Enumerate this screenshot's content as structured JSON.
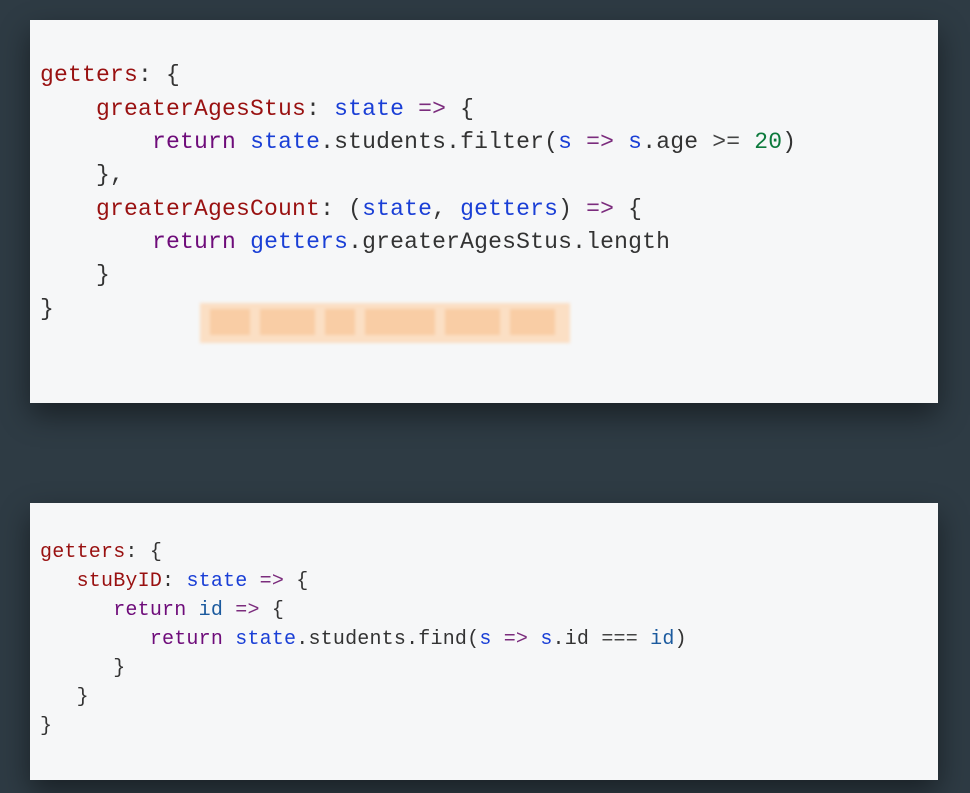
{
  "block1": {
    "l1_getters": "getters",
    "l1_colonBrace": ": {",
    "l2_indent": "    ",
    "l2_name": "greaterAgesStus",
    "l2_colon": ": ",
    "l2_state": "state",
    "l2_arrow": " => ",
    "l2_brace": "{",
    "l3_indent": "        ",
    "l3_return": "return",
    "l3_sp": " ",
    "l3_state": "state",
    "l3_dot1": ".students.",
    "l3_filter": "filter",
    "l3_p1": "(",
    "l3_s": "s",
    "l3_arrow": " => ",
    "l3_s2": "s",
    "l3_age": ".age ",
    "l3_op": ">=",
    "l3_sp2": " ",
    "l3_num": "20",
    "l3_p2": ")",
    "l4_indent": "    ",
    "l4_close": "},",
    "l5_indent": "    ",
    "l5_name": "greaterAgesCount",
    "l5_colon": ": (",
    "l5_state": "state",
    "l5_comma": ", ",
    "l5_getters": "getters",
    "l5_p2": ")",
    "l5_arrow": " => ",
    "l5_brace": "{",
    "l6_indent": "        ",
    "l6_return": "return",
    "l6_sp": " ",
    "l6_getters": "getters",
    "l6_rest": ".greaterAgesStus.length",
    "l7_indent": "    ",
    "l7_close": "}",
    "l8_close": "}"
  },
  "block2": {
    "l1_getters": "getters",
    "l1_colonBrace": ": {",
    "l2_indent": "   ",
    "l2_name": "stuByID",
    "l2_colon": ": ",
    "l2_state": "state",
    "l2_arrow": " => ",
    "l2_brace": "{",
    "l3_indent": "      ",
    "l3_return": "return",
    "l3_sp": " ",
    "l3_id": "id",
    "l3_arrow": " => ",
    "l3_brace": "{",
    "l4_indent": "         ",
    "l4_return": "return",
    "l4_sp": " ",
    "l4_state": "state",
    "l4_dot1": ".students.",
    "l4_find": "find",
    "l4_p1": "(",
    "l4_s": "s",
    "l4_arrow": " => ",
    "l4_s2": "s",
    "l4_dotid": ".id ",
    "l4_eq": "===",
    "l4_sp2": " ",
    "l4_id2": "id",
    "l4_p2": ")",
    "l5_indent": "      ",
    "l5_close": "}",
    "l6_indent": "   ",
    "l6_close": "}",
    "l7_close": "}"
  }
}
